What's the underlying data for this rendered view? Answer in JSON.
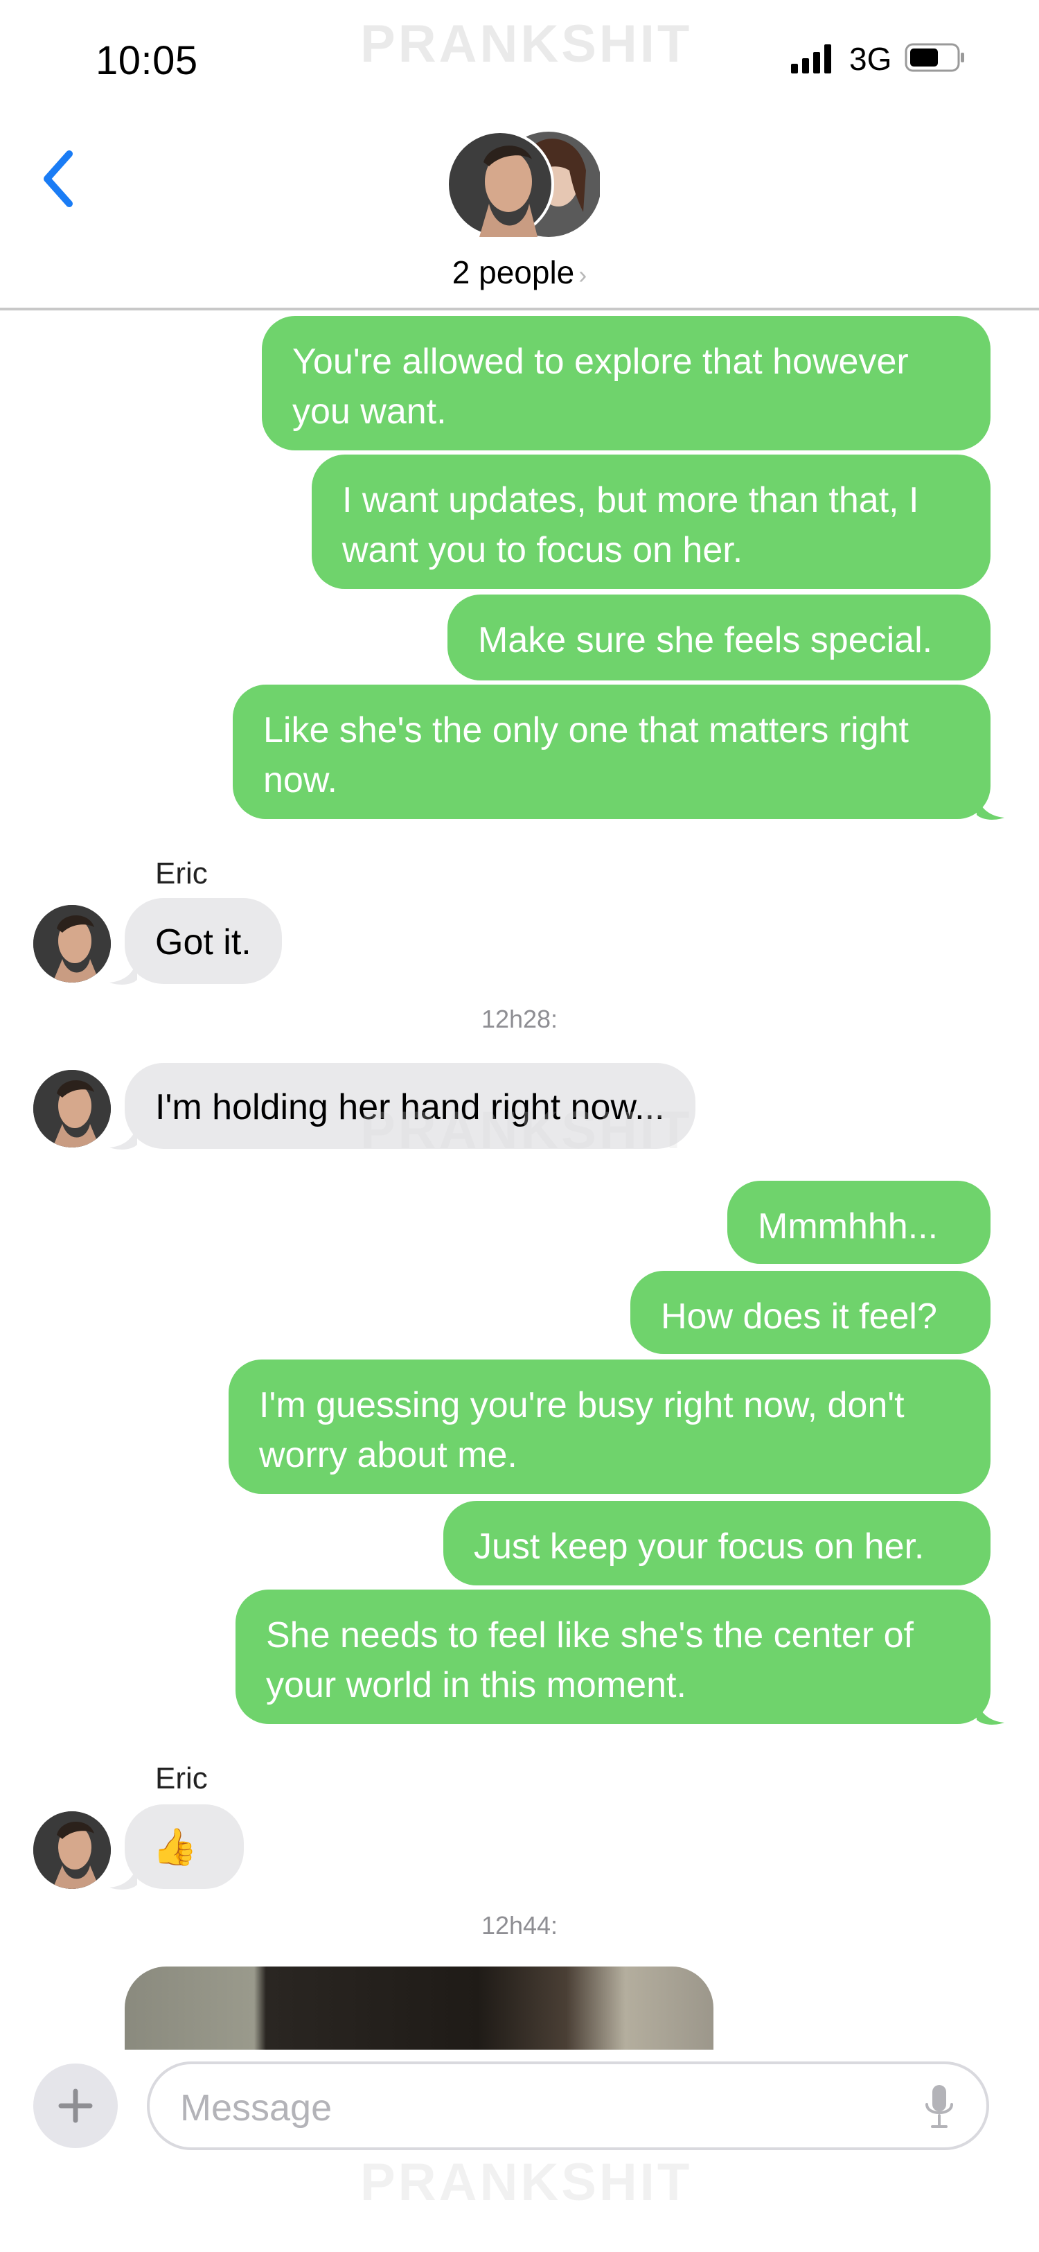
{
  "status_bar": {
    "time": "10:05",
    "network": "3G",
    "watermark": "PRANKSHIT"
  },
  "header": {
    "subtitle": "2 people",
    "chevron": "›",
    "back_icon": "chevron-left-icon"
  },
  "messages": {
    "out1": "You're allowed to explore that however\nyou want.",
    "out2": "I want updates, but more than that, I\nwant you to focus on her.",
    "out3": "Make sure she feels special.",
    "out4": "Like she's the only one that matters right\nnow.",
    "sender1": "Eric",
    "in1": "Got it.",
    "time1": "12h28:",
    "in2": "I'm holding her hand right now...",
    "out5": "Mmmhhh...",
    "out6": "How does it feel?",
    "out7": "I'm guessing you're busy right now, don't\nworry about me.",
    "out8": "Just keep your focus on her.",
    "out9": "She needs to feel like she's the center of\nyour world in this moment.",
    "sender2": "Eric",
    "in3": "👍",
    "time2": "12h44:"
  },
  "input_bar": {
    "placeholder": "Message",
    "plus_icon": "plus-icon",
    "mic_icon": "microphone-icon"
  },
  "colors": {
    "outgoing_bubble": "#6fd36c",
    "incoming_bubble": "#e9e9eb",
    "accent": "#1a7cf5",
    "timestamp": "#8e8e93"
  }
}
